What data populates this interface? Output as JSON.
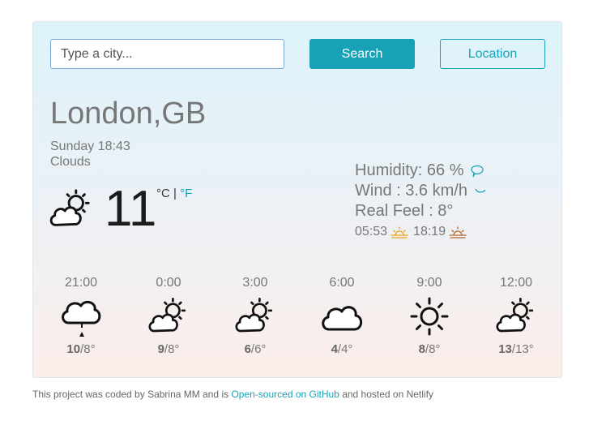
{
  "search": {
    "placeholder": "Type a city...",
    "search_label": "Search",
    "location_label": "Location"
  },
  "current": {
    "city": "London,GB",
    "datetime": "Sunday 18:43",
    "description": "Clouds",
    "temperature": "11",
    "unit_c": "°C",
    "unit_sep": " | ",
    "unit_f": "°F",
    "icon": "partly-cloudy-icon",
    "humidity": "Humidity: 66 %",
    "wind": "Wind : 3.6 km/h",
    "real_feel": "Real Feel : 8°",
    "sunrise": "05:53",
    "sunset": "18:19"
  },
  "forecast": [
    {
      "time": "21:00",
      "high": "10",
      "low": "/8°",
      "icon": "rain-cloud-icon"
    },
    {
      "time": "0:00",
      "high": "9",
      "low": "/8°",
      "icon": "partly-cloudy-icon"
    },
    {
      "time": "3:00",
      "high": "6",
      "low": "/6°",
      "icon": "partly-cloudy-icon"
    },
    {
      "time": "6:00",
      "high": "4",
      "low": "/4°",
      "icon": "cloud-icon"
    },
    {
      "time": "9:00",
      "high": "8",
      "low": "/8°",
      "icon": "sun-icon"
    },
    {
      "time": "12:00",
      "high": "13",
      "low": "/13°",
      "icon": "partly-cloudy-icon"
    }
  ],
  "footer": {
    "prefix": "This project was coded by Sabrina MM and is ",
    "link": "Open-sourced on GitHub",
    "suffix": " and hosted on Netlify"
  },
  "colors": {
    "accent": "#17a2b8",
    "text": "#777777"
  }
}
